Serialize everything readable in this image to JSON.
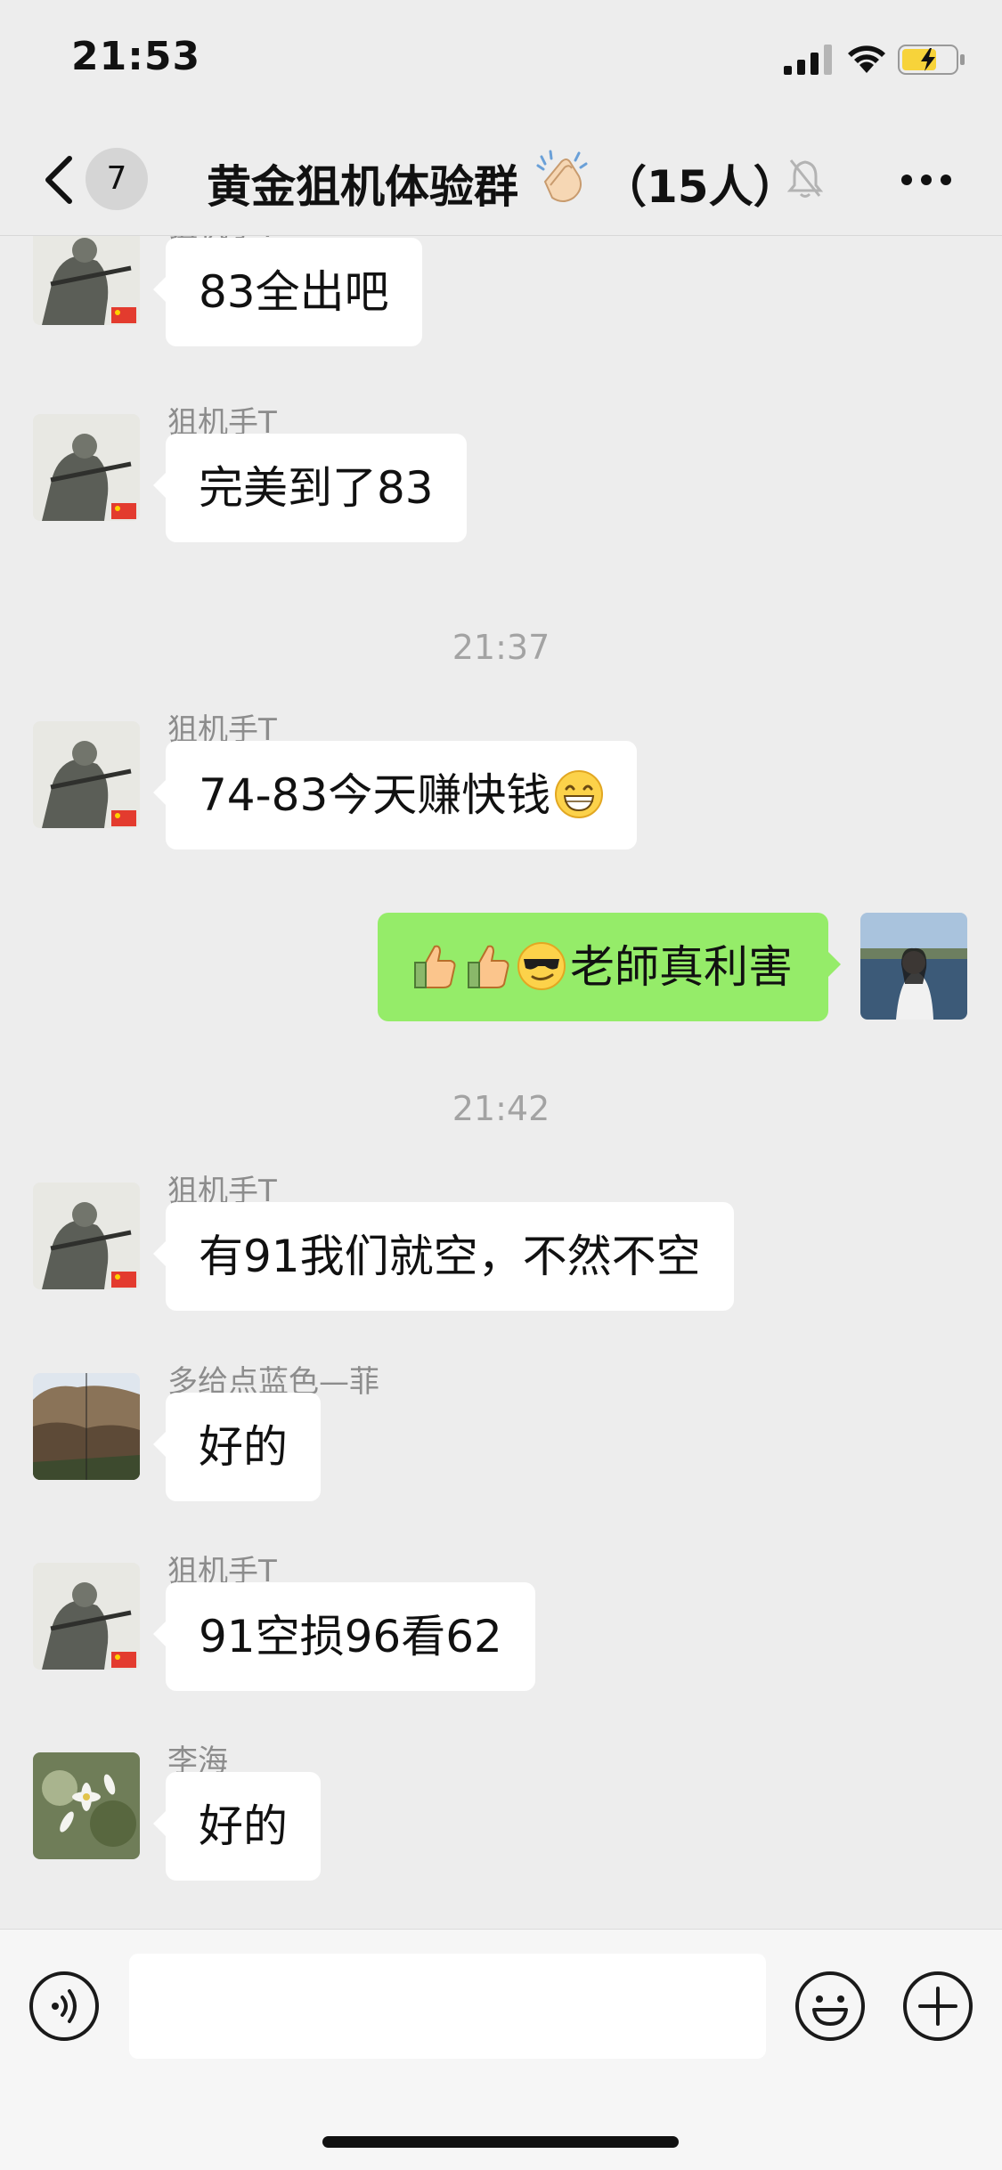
{
  "status_bar": {
    "time": "21:53"
  },
  "nav": {
    "unread_count": "7",
    "title": "黄金狙机体验群",
    "member_count": "（15人）"
  },
  "messages": [
    {
      "type": "text",
      "sender": "狙机手T",
      "text": "83全出吧",
      "avatar": "sniper-avatar"
    },
    {
      "type": "text",
      "sender": "狙机手T",
      "text": "完美到了83",
      "avatar": "sniper-avatar"
    },
    {
      "type": "time",
      "text": "21:37"
    },
    {
      "type": "text",
      "sender": "狙机手T",
      "text": "74-83今天赚快钱",
      "avatar": "sniper-avatar"
    },
    {
      "type": "self",
      "text": "老師真利害",
      "avatar": "self-avatar"
    },
    {
      "type": "time",
      "text": "21:42"
    },
    {
      "type": "text",
      "sender": "狙机手T",
      "text": "有91我们就空，不然不空",
      "avatar": "sniper-avatar"
    },
    {
      "type": "text",
      "sender": "多给点蓝色—菲",
      "text": "好的",
      "avatar": "cliff-avatar"
    },
    {
      "type": "text",
      "sender": "狙机手T",
      "text": "91空损96看62",
      "avatar": "sniper-avatar"
    },
    {
      "type": "text",
      "sender": "李海",
      "text": "好的",
      "avatar": "flower-avatar"
    }
  ],
  "input": {
    "placeholder": "",
    "value": ""
  },
  "colors": {
    "self_bubble": "#95ec69",
    "chat_bg": "#ededed",
    "bubble": "#ffffff"
  },
  "icons": [
    "back-chevron-icon",
    "clap-emoji-icon",
    "mute-bell-icon",
    "more-dots-icon",
    "voice-icon",
    "emoji-face-icon",
    "plus-icon",
    "grin-emoji-icon",
    "thumbs-up-emoji-icon",
    "sunglasses-emoji-icon"
  ]
}
